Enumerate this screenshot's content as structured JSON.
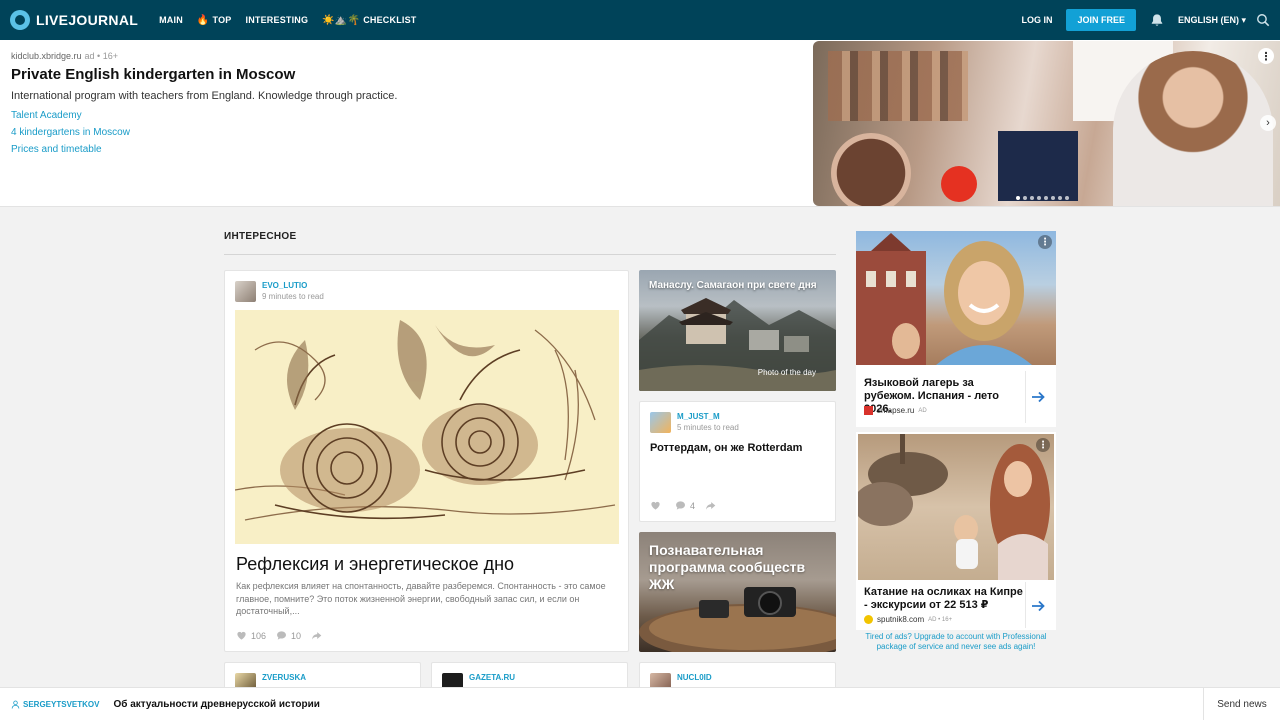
{
  "header": {
    "logo": "LIVEJOURNAL",
    "nav": [
      {
        "label": "MAIN",
        "emoji": ""
      },
      {
        "label": "TOP",
        "emoji": "🔥"
      },
      {
        "label": "INTERESTING",
        "emoji": ""
      },
      {
        "label": "CHECKLIST",
        "emoji": "☀️⛰️🌴"
      }
    ],
    "login": "LOG IN",
    "join": "JOIN FREE",
    "language": "ENGLISH (EN) ▾"
  },
  "banner": {
    "domain": "kidclub.xbridge.ru",
    "ad_label": "ad • 16+",
    "title": "Private English kindergarten in Moscow",
    "description": "International program with teachers from England. Knowledge through practice.",
    "links": [
      "Talent Academy",
      "4 kindergartens in Moscow",
      "Prices and timetable"
    ],
    "menu": "⋮",
    "next": "›"
  },
  "section": {
    "title": "ИНТЕРЕСНОЕ"
  },
  "main_post": {
    "author": "EVO_LUTIO",
    "read_time": "9 minutes to read",
    "title": "Рефлексия и энергетическое дно",
    "excerpt": "Как рефлексия влияет на спонтанность, давайте разберемся. Спонтанность - это самое главное, помните? Это поток жизненной энергии, свободный запас сил, и если он достаточный,...",
    "likes": "106",
    "comments": "10"
  },
  "photo_day": {
    "title": "Манаслу. Самагаон при свете дня",
    "badge": "Photo of the day"
  },
  "post_two": {
    "author": "M_JUST_M",
    "read_time": "5 minutes to read",
    "title": "Роттердам, он же Rotterdam",
    "comments": "4"
  },
  "community": {
    "title": "Познавательная программа сообществ ЖЖ"
  },
  "bottom_posts": [
    {
      "author": "ZVERUSKA"
    },
    {
      "author": "GAZETA.RU"
    },
    {
      "author": "NUCL0ID"
    }
  ],
  "ads": [
    {
      "title": "Языковой лагерь за рубежом. Испания - лето 2026.",
      "source": "smapse.ru",
      "tag": "AD"
    },
    {
      "title": "Катание на осликах на Кипре - экскурсии от 22 513 ₽",
      "source": "sputnik8.com",
      "tag": "AD • 16+"
    }
  ],
  "tired_ads": "Tired of ads? Upgrade to account with Professional package of service and never see ads again!",
  "bottom_bar": {
    "user": "SERGEYTSVETKOV",
    "title": "Об актуальности древнерусской истории",
    "send": "Send news"
  }
}
